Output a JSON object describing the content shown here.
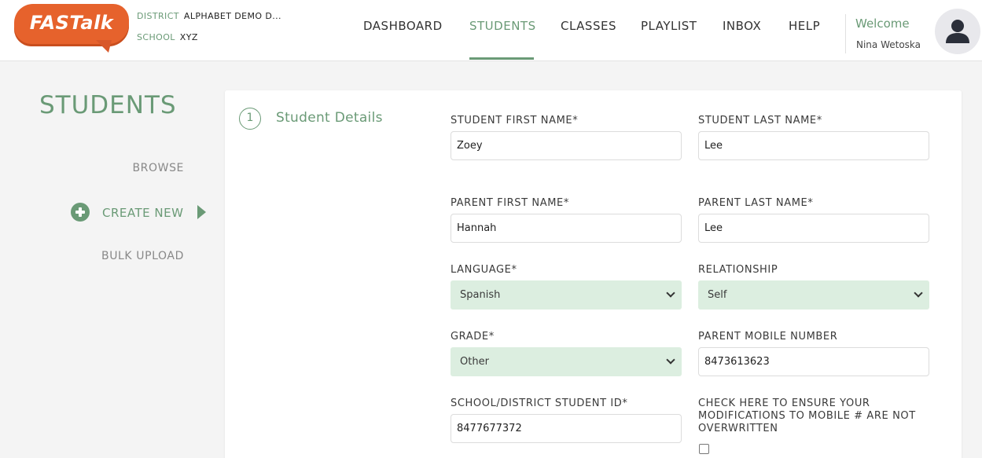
{
  "brand": {
    "logo_text": "FASTalk",
    "logo_color": "#e6622c"
  },
  "header": {
    "district_label": "DISTRICT",
    "district_value": "ALPHABET DEMO D...",
    "school_label": "SCHOOL",
    "school_value": "XYZ",
    "nav": [
      {
        "label": "DASHBOARD",
        "active": false
      },
      {
        "label": "STUDENTS",
        "active": true
      },
      {
        "label": "CLASSES",
        "active": false
      },
      {
        "label": "PLAYLIST",
        "active": false
      },
      {
        "label": "INBOX",
        "active": false
      },
      {
        "label": "HELP",
        "active": false
      }
    ],
    "welcome": "Welcome",
    "user_name": "Nina Wetoska",
    "avatar_icon": "user-silhouette-icon"
  },
  "sidebar": {
    "title": "STUDENTS",
    "browse": "BROWSE",
    "create_new": "CREATE NEW",
    "bulk_upload": "BULK UPLOAD",
    "create_icon": "plus-circle-icon",
    "active_icon": "triangle-right-icon"
  },
  "form": {
    "step_number": "1",
    "step_title": "Student Details",
    "fields": {
      "student_first_name": {
        "label": "STUDENT FIRST NAME*",
        "value": "Zoey"
      },
      "student_last_name": {
        "label": "STUDENT LAST NAME*",
        "value": "Lee"
      },
      "parent_first_name": {
        "label": "PARENT FIRST NAME*",
        "value": "Hannah"
      },
      "parent_last_name": {
        "label": "PARENT LAST NAME*",
        "value": "Lee"
      },
      "language": {
        "label": "LANGUAGE*",
        "value": "Spanish"
      },
      "relationship": {
        "label": "RELATIONSHIP",
        "value": "Self"
      },
      "grade": {
        "label": "GRADE*",
        "value": "Other"
      },
      "parent_mobile": {
        "label": "PARENT MOBILE NUMBER",
        "value": "8473613623"
      },
      "student_id": {
        "label": "SCHOOL/DISTRICT STUDENT ID*",
        "value": "8477677372"
      },
      "mobile_check": {
        "label": "CHECK HERE TO ENSURE YOUR MODIFICATIONS TO MOBILE # ARE NOT OVERWRITTEN",
        "checked": false
      }
    }
  },
  "colors": {
    "accent_green": "#6a9a76",
    "select_bg": "#dceee0",
    "page_bg": "#f4f4f4"
  }
}
